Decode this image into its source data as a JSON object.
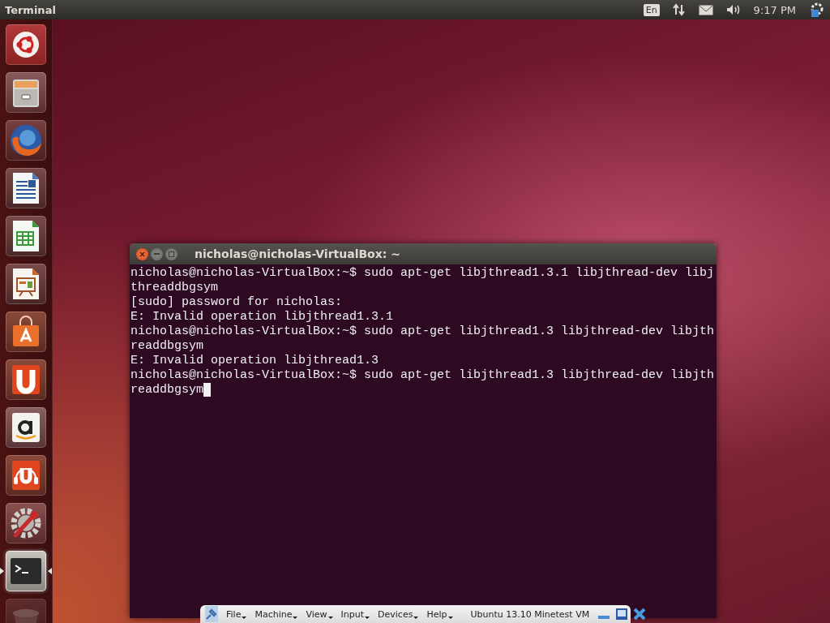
{
  "top_panel": {
    "app_title": "Terminal",
    "keyboard_layout": "En",
    "clock": "9:17 PM"
  },
  "launcher": {
    "items": [
      {
        "kind": "dash",
        "selected": false
      },
      {
        "kind": "files",
        "selected": false
      },
      {
        "kind": "browser",
        "selected": false
      },
      {
        "kind": "writer",
        "selected": false
      },
      {
        "kind": "calc",
        "selected": false
      },
      {
        "kind": "impress",
        "selected": false
      },
      {
        "kind": "store",
        "selected": false
      },
      {
        "kind": "ubuntu-one",
        "selected": false
      },
      {
        "kind": "amazon",
        "selected": false
      },
      {
        "kind": "music",
        "selected": false
      },
      {
        "kind": "settings",
        "selected": false
      },
      {
        "kind": "terminal",
        "selected": true
      },
      {
        "kind": "trash",
        "selected": false
      }
    ]
  },
  "terminal": {
    "title": "nicholas@nicholas-VirtualBox: ~",
    "cursor": true,
    "lines": [
      "nicholas@nicholas-VirtualBox:~$ sudo apt-get libjthread1.3.1 libjthread-dev libj",
      "threaddbgsym",
      "[sudo] password for nicholas:",
      "E: Invalid operation libjthread1.3.1",
      "nicholas@nicholas-VirtualBox:~$ sudo apt-get libjthread1.3 libjthread-dev libjth",
      "readdbgsym",
      "E: Invalid operation libjthread1.3",
      "nicholas@nicholas-VirtualBox:~$ sudo apt-get libjthread1.3 libjthread-dev libjth",
      "readdbgsym"
    ]
  },
  "vm_toolbar": {
    "menus": [
      "File",
      "Machine",
      "View",
      "Input",
      "Devices",
      "Help"
    ],
    "vm_name": "Ubuntu 13.10 Minetest VM"
  }
}
